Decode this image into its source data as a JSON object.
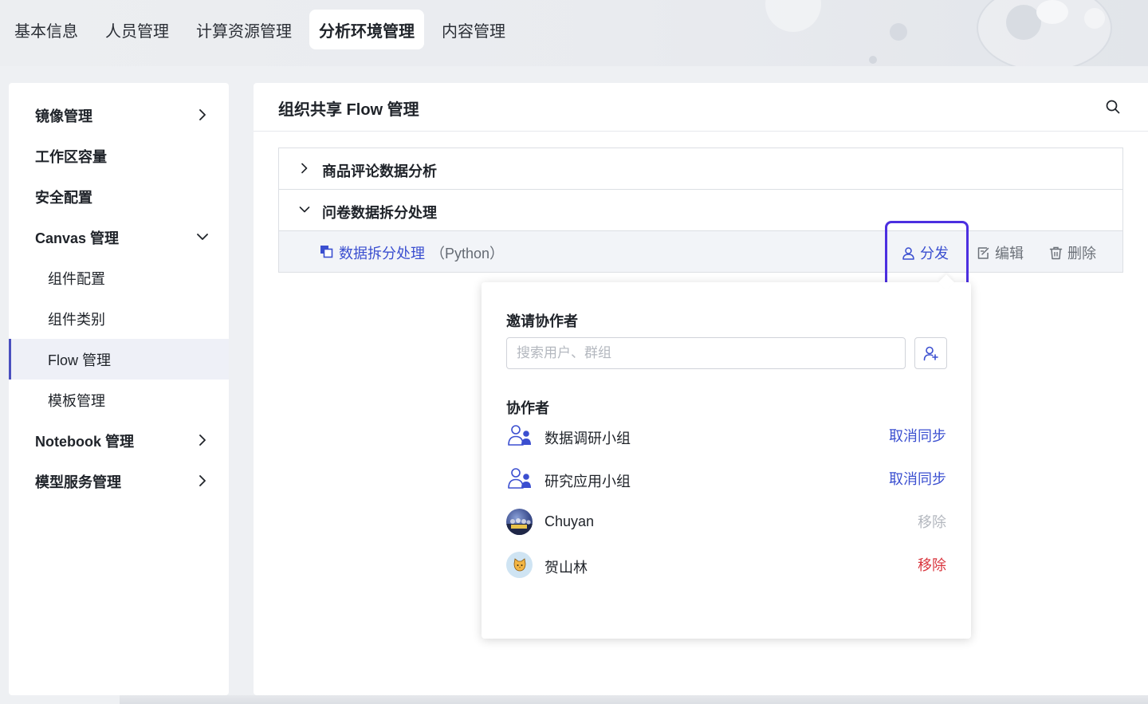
{
  "topnav": {
    "items": [
      {
        "label": "基本信息",
        "active": false
      },
      {
        "label": "人员管理",
        "active": false
      },
      {
        "label": "计算资源管理",
        "active": false
      },
      {
        "label": "分析环境管理",
        "active": true
      },
      {
        "label": "内容管理",
        "active": false
      }
    ]
  },
  "sidebar": {
    "items": [
      {
        "label": "镜像管理",
        "level": 1,
        "chevron": "chevron-right-icon"
      },
      {
        "label": "工作区容量",
        "level": 1
      },
      {
        "label": "安全配置",
        "level": 1
      },
      {
        "label": "Canvas 管理",
        "level": 1,
        "chevron": "chevron-down-icon",
        "expanded": true
      },
      {
        "label": "组件配置",
        "level": 2
      },
      {
        "label": "组件类别",
        "level": 2
      },
      {
        "label": "Flow 管理",
        "level": 2,
        "active": true
      },
      {
        "label": "模板管理",
        "level": 2
      },
      {
        "label": "Notebook 管理",
        "level": 1,
        "chevron": "chevron-right-icon"
      },
      {
        "label": "模型服务管理",
        "level": 1,
        "chevron": "chevron-right-icon"
      }
    ]
  },
  "main": {
    "title": "组织共享 Flow 管理",
    "search_icon": "search-icon",
    "flows": [
      {
        "label": "商品评论数据分析",
        "expanded": false
      },
      {
        "label": "问卷数据拆分处理",
        "expanded": true
      }
    ],
    "child": {
      "icon": "copy-icon",
      "name": "数据拆分处理",
      "lang": "（Python）",
      "actions": {
        "share": "分发",
        "edit": "编辑",
        "delete": "删除"
      }
    }
  },
  "popover": {
    "invite_title": "邀请协作者",
    "search_placeholder": "搜索用户、群组",
    "add_icon": "add-user-icon",
    "collab_title": "协作者",
    "collaborators": [
      {
        "name": "数据调研小组",
        "type": "group",
        "action": "取消同步",
        "action_style": "blue"
      },
      {
        "name": "研究应用小组",
        "type": "group",
        "action": "取消同步",
        "action_style": "blue"
      },
      {
        "name": "Chuyan",
        "type": "user-photo",
        "action": "移除",
        "action_style": "gray"
      },
      {
        "name": "贺山林",
        "type": "user-cat",
        "action": "移除",
        "action_style": "red"
      }
    ]
  },
  "colors": {
    "accent": "#3b4fd0",
    "highlight": "#4c2fe0",
    "danger": "#d9363e",
    "active_bg": "#eef0f7"
  }
}
